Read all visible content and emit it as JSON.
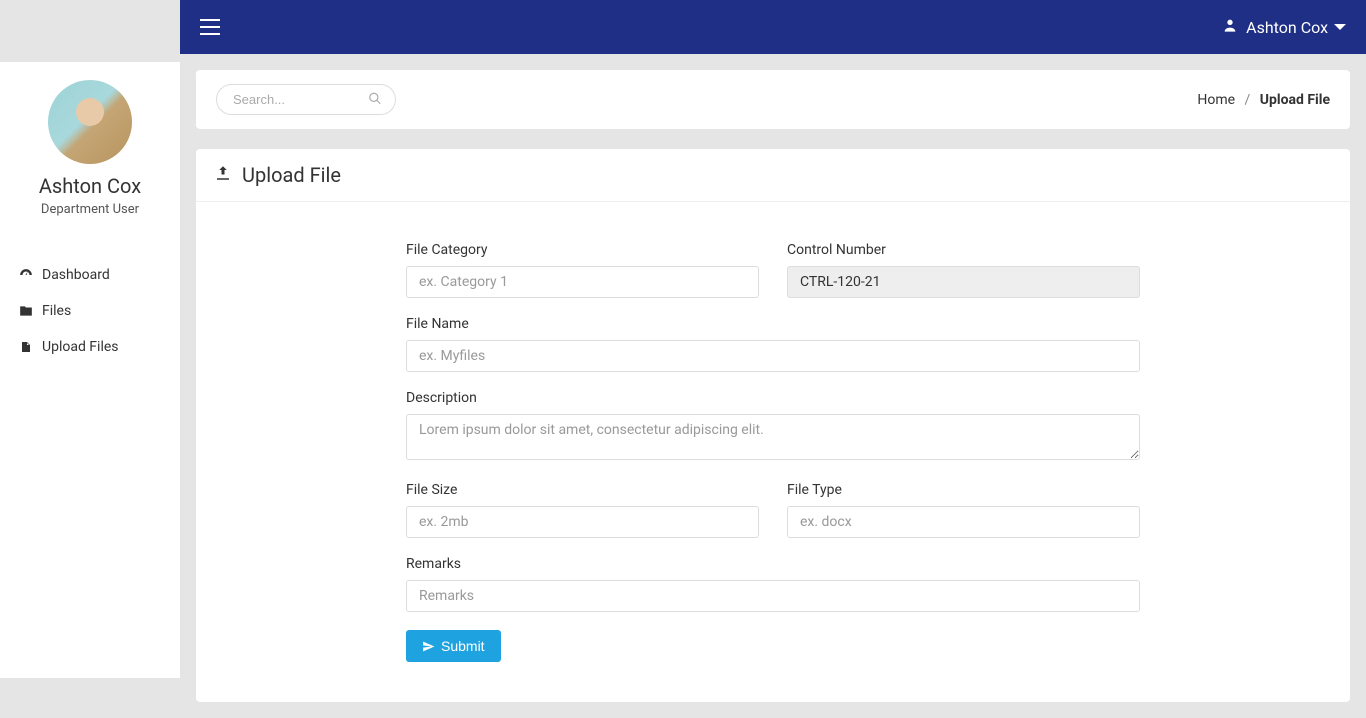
{
  "topbar": {
    "user_name": "Ashton Cox"
  },
  "sidebar": {
    "profile_name": "Ashton Cox",
    "profile_role": "Department User",
    "nav": [
      {
        "label": "Dashboard"
      },
      {
        "label": "Files"
      },
      {
        "label": "Upload Files"
      }
    ]
  },
  "header": {
    "search_placeholder": "Search...",
    "breadcrumb": {
      "home": "Home",
      "current": "Upload File"
    }
  },
  "form": {
    "title": "Upload File",
    "file_category": {
      "label": "File Category",
      "placeholder": "ex. Category 1",
      "value": ""
    },
    "control_number": {
      "label": "Control Number",
      "value": "CTRL-120-21"
    },
    "file_name": {
      "label": "File Name",
      "placeholder": "ex. Myfiles",
      "value": ""
    },
    "description": {
      "label": "Description",
      "placeholder": "Lorem ipsum dolor sit amet, consectetur adipiscing elit.",
      "value": ""
    },
    "file_size": {
      "label": "File Size",
      "placeholder": "ex. 2mb",
      "value": ""
    },
    "file_type": {
      "label": "File Type",
      "placeholder": "ex. docx",
      "value": ""
    },
    "remarks": {
      "label": "Remarks",
      "placeholder": "Remarks",
      "value": ""
    },
    "submit_label": "Submit"
  }
}
